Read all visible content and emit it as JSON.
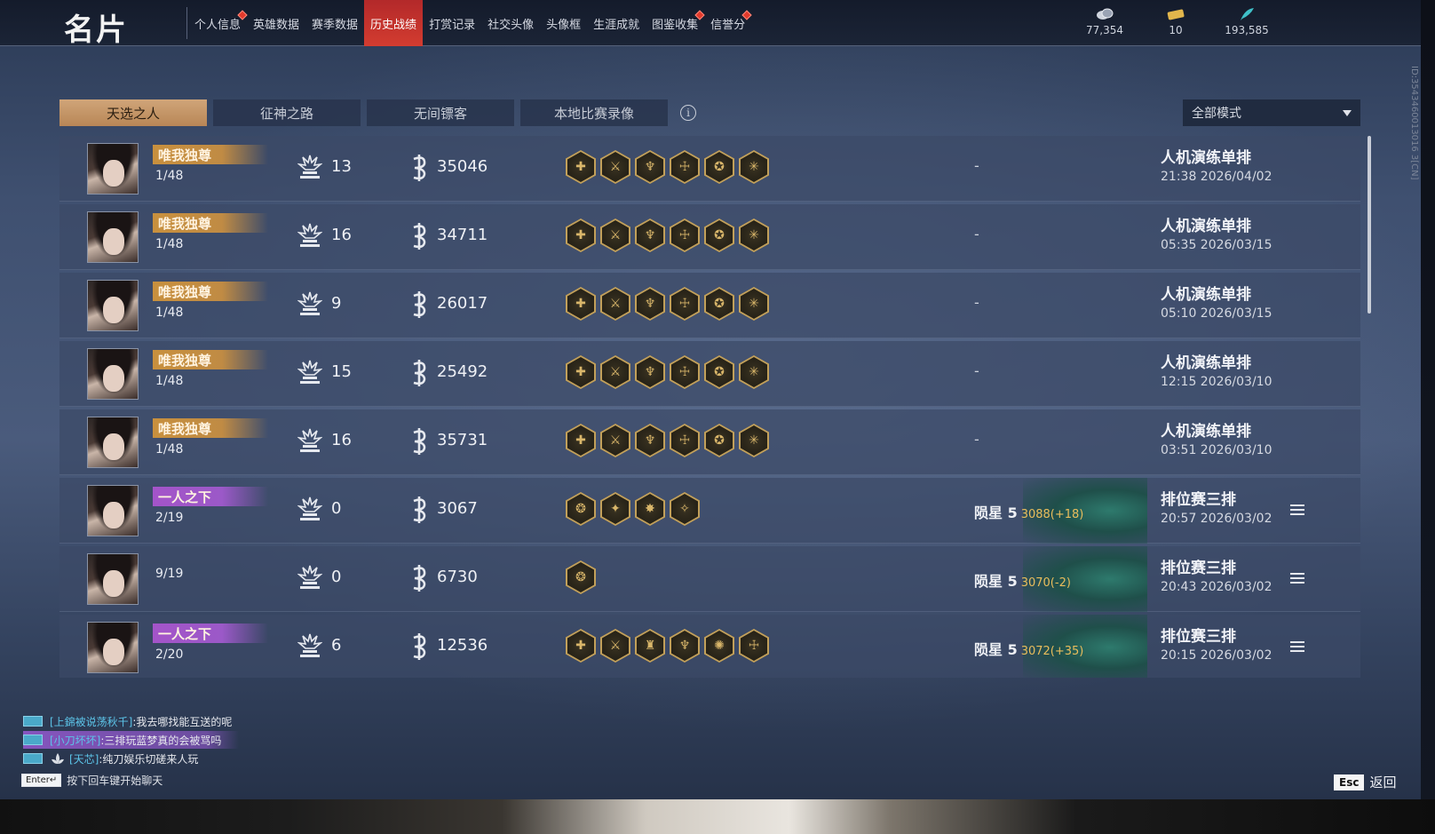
{
  "header": {
    "title": "名片",
    "tabs": [
      {
        "label": "个人信息",
        "dot": true
      },
      {
        "label": "英雄数据",
        "dot": false
      },
      {
        "label": "赛季数据",
        "dot": false
      },
      {
        "label": "历史战绩",
        "dot": false,
        "active": true
      },
      {
        "label": "打赏记录",
        "dot": false
      },
      {
        "label": "社交头像",
        "dot": false
      },
      {
        "label": "头像框",
        "dot": false
      },
      {
        "label": "生涯成就",
        "dot": false
      },
      {
        "label": "图鉴收集",
        "dot": true
      },
      {
        "label": "信誉分",
        "dot": false,
        "dot2": true
      }
    ],
    "currencies": [
      {
        "icon": "coins-icon",
        "value": "77,354"
      },
      {
        "icon": "ticket-icon",
        "value": "10"
      },
      {
        "icon": "feather-icon",
        "value": "193,585"
      }
    ]
  },
  "subtabs": [
    {
      "label": "天选之人",
      "active": true
    },
    {
      "label": "征神之路",
      "active": false
    },
    {
      "label": "无间镖客",
      "active": false
    },
    {
      "label": "本地比赛录像",
      "active": false
    }
  ],
  "mode_select": {
    "value": "全部模式"
  },
  "side_id": "ID:3543460013016 3[CN]",
  "matches": [
    {
      "avatar": "avatar-eyepatch",
      "badge": "唯我独尊",
      "badge_style": "gold",
      "placement": "1/48",
      "kills": "13",
      "damage": "35046",
      "items": [
        "✚",
        "⚔",
        "♆",
        "☩",
        "✪",
        "✳"
      ],
      "rank": "-",
      "score": "",
      "mode": "人机演练单排",
      "time": "21:38 2026/04/02"
    },
    {
      "avatar": "avatar-eyepatch",
      "badge": "唯我独尊",
      "badge_style": "gold",
      "placement": "1/48",
      "kills": "16",
      "damage": "34711",
      "items": [
        "✚",
        "⚔",
        "♆",
        "☩",
        "✪",
        "✳"
      ],
      "rank": "-",
      "score": "",
      "mode": "人机演练单排",
      "time": "05:35 2026/03/15"
    },
    {
      "avatar": "avatar-girl",
      "badge": "唯我独尊",
      "badge_style": "gold",
      "placement": "1/48",
      "kills": "9",
      "damage": "26017",
      "items": [
        "✚",
        "⚔",
        "♆",
        "☩",
        "✪",
        "✳"
      ],
      "rank": "-",
      "score": "",
      "mode": "人机演练单排",
      "time": "05:10 2026/03/15"
    },
    {
      "avatar": "avatar-girl",
      "badge": "唯我独尊",
      "badge_style": "gold",
      "placement": "1/48",
      "kills": "15",
      "damage": "25492",
      "items": [
        "✚",
        "⚔",
        "♆",
        "☩",
        "✪",
        "✳"
      ],
      "rank": "-",
      "score": "",
      "mode": "人机演练单排",
      "time": "12:15 2026/03/10"
    },
    {
      "avatar": "avatar-girl",
      "badge": "唯我独尊",
      "badge_style": "gold",
      "placement": "1/48",
      "kills": "16",
      "damage": "35731",
      "items": [
        "✚",
        "⚔",
        "♆",
        "☩",
        "✪",
        "✳"
      ],
      "rank": "-",
      "score": "",
      "mode": "人机演练单排",
      "time": "03:51 2026/03/10"
    },
    {
      "avatar": "avatar-girl",
      "badge": "一人之下",
      "badge_style": "purple",
      "placement": "2/19",
      "kills": "0",
      "damage": "3067",
      "items": [
        "❂",
        "✦",
        "✸",
        "✧"
      ],
      "rank": "陨星 5",
      "score": "3088(+18)",
      "mode": "排位赛三排",
      "time": "20:57 2026/03/02",
      "details": true
    },
    {
      "avatar": "avatar-girl",
      "badge": "",
      "badge_style": "",
      "placement": "9/19",
      "kills": "0",
      "damage": "6730",
      "items": [
        "❂"
      ],
      "rank": "陨星 5",
      "score": "3070(-2)",
      "mode": "排位赛三排",
      "time": "20:43 2026/03/02",
      "details": true
    },
    {
      "avatar": "avatar-girl",
      "badge": "一人之下",
      "badge_style": "purple",
      "placement": "2/20",
      "kills": "6",
      "damage": "12536",
      "items": [
        "✚",
        "⚔",
        "♜",
        "♆",
        "✺",
        "☩"
      ],
      "rank": "陨星 5",
      "score": "3072(+35)",
      "mode": "排位赛三排",
      "time": "20:15 2026/03/02",
      "details": true
    }
  ],
  "chat": [
    {
      "name": "[上錦被说荡秋千]",
      "text": ":我去哪找能互送的呢",
      "highlight": false,
      "badge": false
    },
    {
      "name": "[小刀坏坏]",
      "text": ":三排玩蓝梦真的会被骂吗",
      "highlight": true,
      "badge": false
    },
    {
      "name": "[天芯]",
      "text": ":纯刀娱乐切磋来人玩",
      "highlight": false,
      "badge": true
    }
  ],
  "chat_hint": {
    "key": "Enter↵",
    "text": "按下回车键开始聊天"
  },
  "esc_back": {
    "key": "Esc",
    "label": "返回"
  },
  "colors": {
    "accent_red": "#d33c30",
    "gold_badge": "#c8903e",
    "purple_badge": "#a454c9",
    "score_gold": "#e9bd5c"
  }
}
